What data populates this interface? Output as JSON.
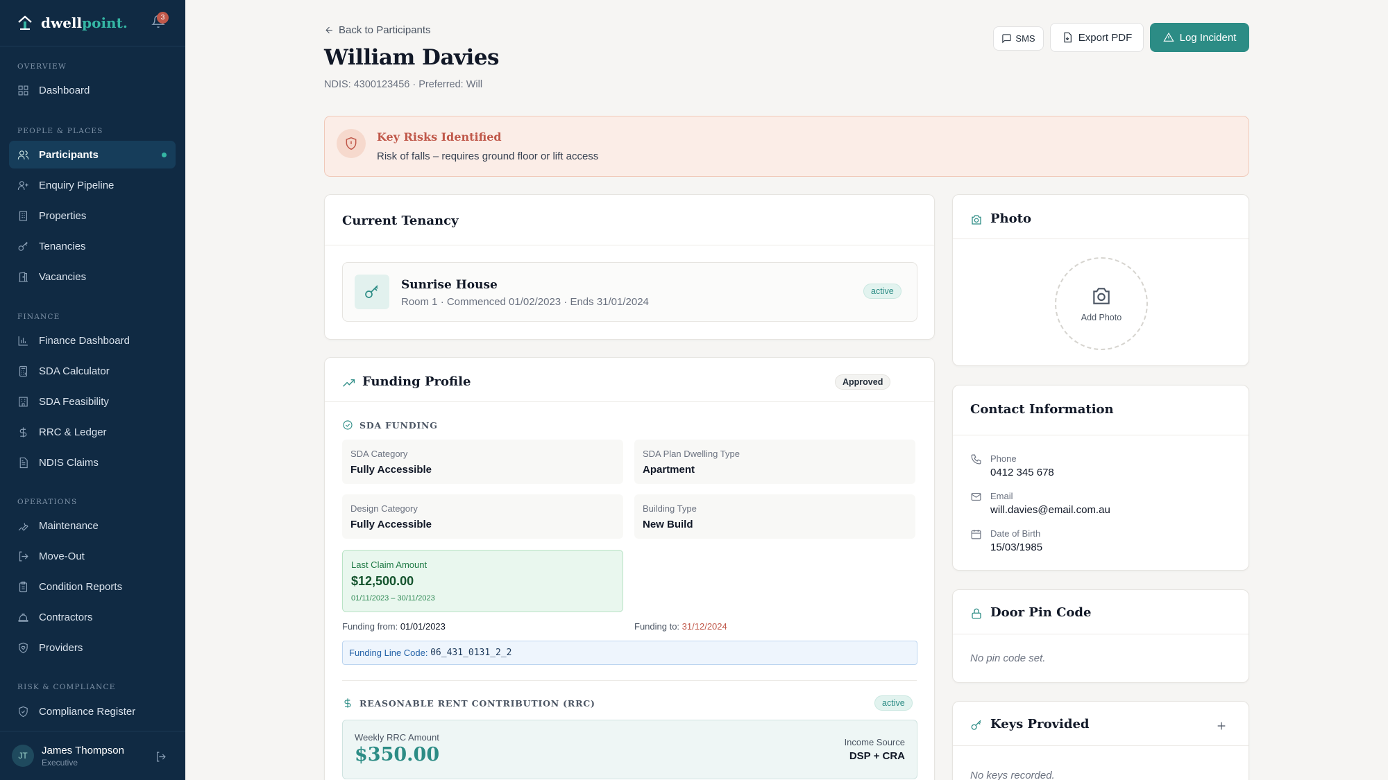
{
  "brand": {
    "name": "dwell",
    "name_accent": "point.",
    "notification_count": "3"
  },
  "nav": {
    "sections": [
      {
        "label": "Overview"
      },
      {
        "label": "People & Places"
      },
      {
        "label": "Finance"
      },
      {
        "label": "Operations"
      },
      {
        "label": "Risk & Compliance"
      }
    ],
    "items": [
      {
        "label": "Dashboard",
        "icon": "grid-icon"
      },
      {
        "label": "Participants",
        "icon": "users-icon",
        "active": true
      },
      {
        "label": "Enquiry Pipeline",
        "icon": "user-plus-icon"
      },
      {
        "label": "Properties",
        "icon": "building-icon"
      },
      {
        "label": "Tenancies",
        "icon": "key-icon"
      },
      {
        "label": "Vacancies",
        "icon": "door-icon"
      },
      {
        "label": "Finance Dashboard",
        "icon": "bar-chart-icon"
      },
      {
        "label": "SDA Calculator",
        "icon": "calculator-icon"
      },
      {
        "label": "SDA Feasibility",
        "icon": "building-check-icon"
      },
      {
        "label": "RRC & Ledger",
        "icon": "dollar-icon"
      },
      {
        "label": "NDIS Claims",
        "icon": "document-icon"
      },
      {
        "label": "Maintenance",
        "icon": "wrench-icon"
      },
      {
        "label": "Move-Out",
        "icon": "log-out-icon"
      },
      {
        "label": "Condition Reports",
        "icon": "clipboard-icon"
      },
      {
        "label": "Contractors",
        "icon": "hard-hat-icon"
      },
      {
        "label": "Providers",
        "icon": "shield-heart-icon"
      },
      {
        "label": "Compliance Register",
        "icon": "shield-check-icon"
      }
    ]
  },
  "user": {
    "initials": "JT",
    "name": "James Thompson",
    "role": "Executive"
  },
  "header": {
    "back_label": "Back to Participants",
    "title": "William Davies",
    "subtitle": "NDIS: 4300123456 · Preferred: Will",
    "sms_label": "SMS",
    "export_label": "Export PDF",
    "incident_label": "Log Incident"
  },
  "risk": {
    "title": "Key Risks Identified",
    "text": "Risk of falls – requires ground floor or lift access"
  },
  "tenancy": {
    "heading": "Current Tenancy",
    "property": "Sunrise House",
    "details": "Room 1 · Commenced 01/02/2023 · Ends 31/01/2024",
    "status": "active"
  },
  "funding": {
    "heading": "Funding Profile",
    "status": "Approved",
    "sda_label": "SDA Funding",
    "fields": [
      {
        "label": "SDA Category",
        "value": "Fully Accessible"
      },
      {
        "label": "SDA Plan Dwelling Type",
        "value": "Apartment"
      },
      {
        "label": "Design Category",
        "value": "Fully Accessible"
      },
      {
        "label": "Building Type",
        "value": "New Build"
      }
    ],
    "last_claim": {
      "label": "Last Claim Amount",
      "amount": "$12,500.00",
      "period": "01/11/2023 – 30/11/2023"
    },
    "from_label": "Funding from:",
    "from_value": "01/01/2023",
    "to_label": "Funding to:",
    "to_value": "31/12/2024",
    "line_code_label": "Funding Line Code:",
    "line_code": "06_431_0131_2_2",
    "rrc_label": "Reasonable Rent Contribution (RRC)",
    "rrc_status": "active",
    "rrc_weekly_label": "Weekly RRC Amount",
    "rrc_weekly": "$350.00",
    "income_label": "Income Source",
    "income_value": "DSP + CRA"
  },
  "photo": {
    "heading": "Photo",
    "add_label": "Add Photo"
  },
  "contact": {
    "heading": "Contact Information",
    "phone_label": "Phone",
    "phone": "0412 345 678",
    "email_label": "Email",
    "email": "will.davies@email.com.au",
    "dob_label": "Date of Birth",
    "dob": "15/03/1985"
  },
  "door_pin": {
    "heading": "Door Pin Code",
    "empty": "No pin code set."
  },
  "keys": {
    "heading": "Keys Provided",
    "empty": "No keys recorded."
  },
  "colors": {
    "sidebar": "#102a43",
    "accent": "#2c8c85",
    "risk": "#c0584a"
  }
}
